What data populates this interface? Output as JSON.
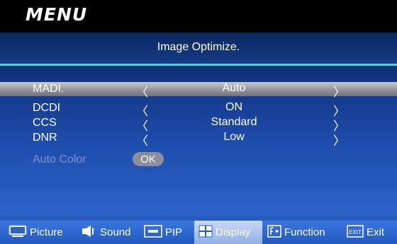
{
  "header": {
    "title": "MENU"
  },
  "page": {
    "title": "Image Optimize."
  },
  "settings": [
    {
      "label": "MADI.",
      "value": "Auto",
      "selected": true,
      "arrow_left": "〈",
      "arrow_right": "〉"
    },
    {
      "label": "DCDI",
      "value": "ON",
      "selected": false,
      "arrow_left": "〈",
      "arrow_right": "〉"
    },
    {
      "label": "CCS",
      "value": "Standard",
      "selected": false,
      "arrow_left": "〈",
      "arrow_right": "〉"
    },
    {
      "label": "DNR",
      "value": "Low",
      "selected": false,
      "arrow_left": "〈",
      "arrow_right": "〉"
    }
  ],
  "auto_color": {
    "label": "Auto Color",
    "button": "OK",
    "enabled": false
  },
  "tabs": [
    {
      "label": "Picture",
      "icon": "monitor-icon",
      "active": false
    },
    {
      "label": "Sound",
      "icon": "speaker-icon",
      "active": false
    },
    {
      "label": "PIP",
      "icon": "pip-icon",
      "active": false
    },
    {
      "label": "Display",
      "icon": "grid-icon",
      "active": true
    },
    {
      "label": "Function",
      "icon": "function-icon",
      "active": false
    },
    {
      "label": "Exit",
      "icon": "exit-icon",
      "active": false
    }
  ],
  "icon_text": {
    "exit": "EXIT"
  },
  "colors": {
    "background": "#1f4fb0",
    "accent_line": "#4fd8d6",
    "selected_row": "#9aa0a8",
    "disabled_text": "#7f93c6",
    "tab_bar": "#2c62cc",
    "active_tab": "#a9c2ef"
  }
}
